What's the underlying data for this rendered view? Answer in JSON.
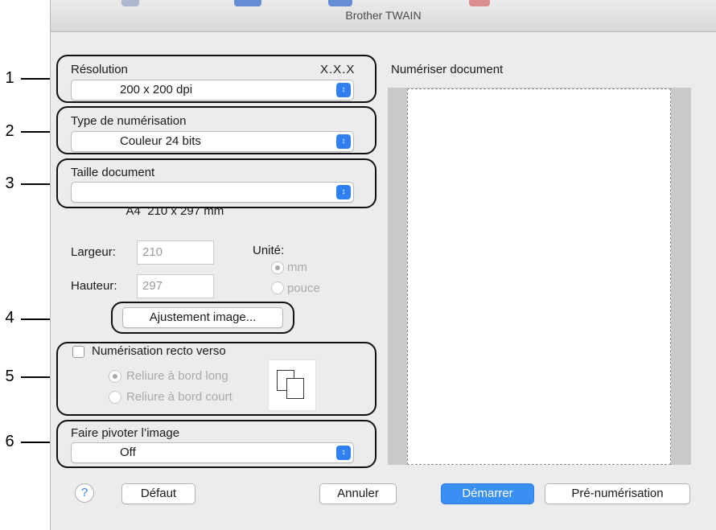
{
  "window": {
    "title": "Brother TWAIN"
  },
  "callouts": [
    "1",
    "2",
    "3",
    "4",
    "5",
    "6"
  ],
  "resolution": {
    "label": "Résolution",
    "version": "X.X.X",
    "value": "200 x 200 dpi"
  },
  "scan_type": {
    "label": "Type de numérisation",
    "value": "Couleur 24 bits"
  },
  "doc_size": {
    "label": "Taille document",
    "value": "A4  210 x 297 mm"
  },
  "dimensions": {
    "width_label": "Largeur:",
    "width_value": "210",
    "height_label": "Hauteur:",
    "height_value": "297",
    "unit_label": "Unité:",
    "unit_mm": "mm",
    "unit_inch": "pouce"
  },
  "adjust_button": "Ajustement image...",
  "duplex": {
    "label": "Numérisation recto verso",
    "long_edge": "Reliure à bord long",
    "short_edge": "Reliure à bord court"
  },
  "rotate": {
    "label": "Faire pivoter l’image",
    "value": "Off"
  },
  "preview": {
    "label": "Numériser document"
  },
  "buttons": {
    "help": "?",
    "default": "Défaut",
    "cancel": "Annuler",
    "start": "Démarrer",
    "prescan": "Pré-numérisation"
  },
  "colors": {
    "accent": "#3a8ff5",
    "popup_arrow": "#2f7ff1"
  },
  "icons": {
    "help": "help-icon",
    "popup": "chevron-updown-icon",
    "duplex": "duplex-pages-icon"
  }
}
